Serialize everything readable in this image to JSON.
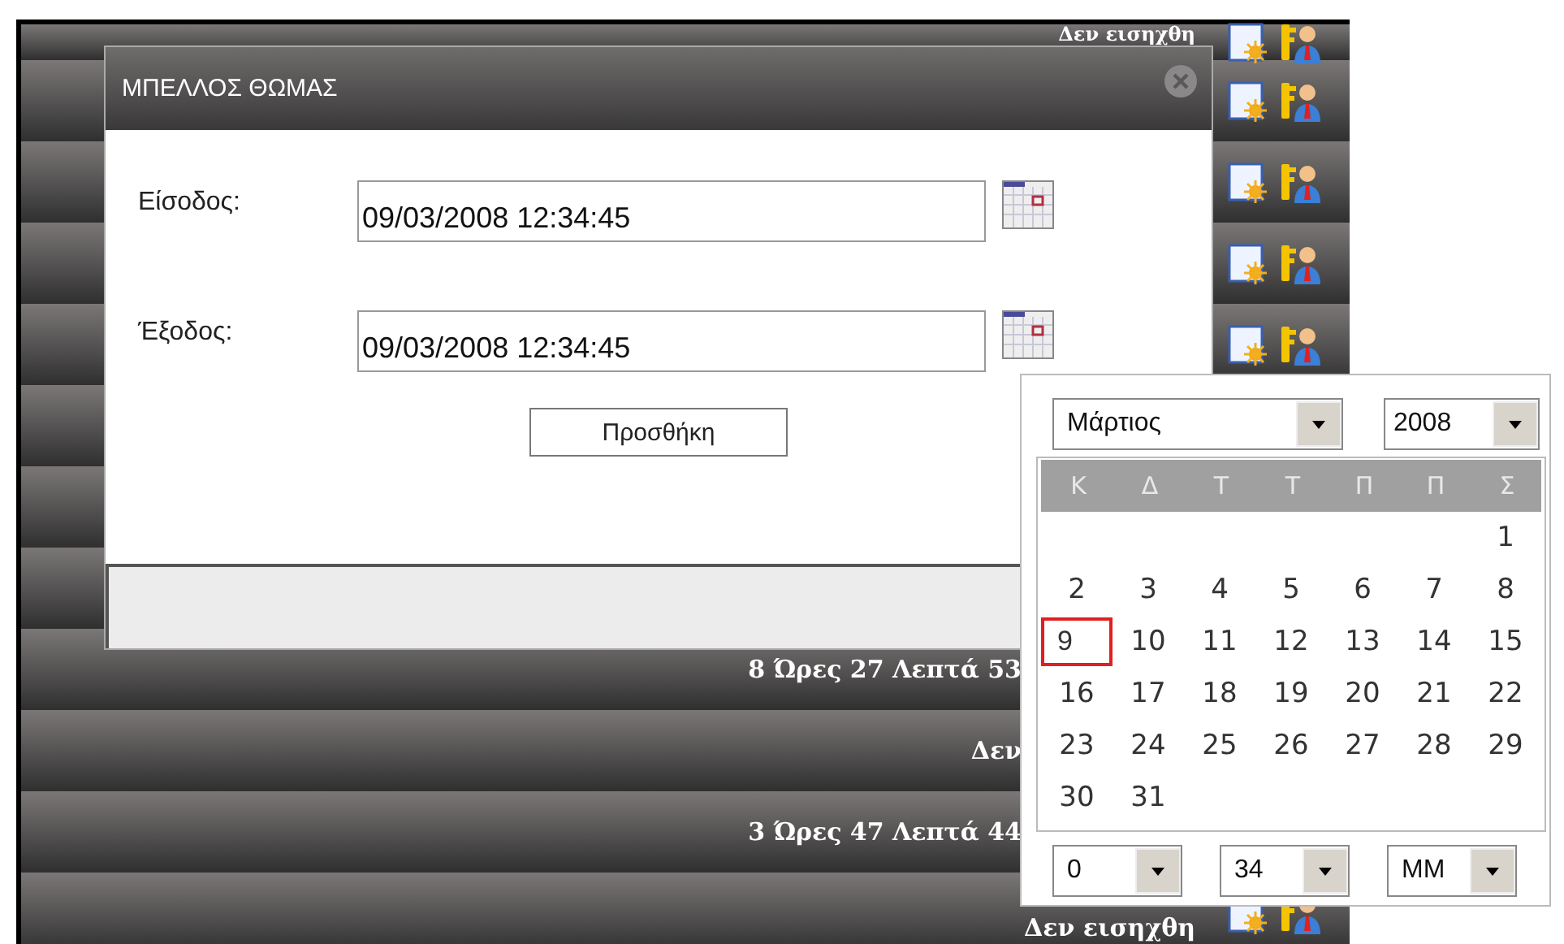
{
  "table": {
    "rows": [
      {
        "status": "Δεν εισηχθη",
        "icons": true
      },
      {
        "icons": true
      },
      {
        "icons": true
      },
      {
        "icons": true
      },
      {
        "icons": true
      },
      {},
      {},
      {},
      {
        "status": "8 Ώρες 27 Λεπτά 53"
      },
      {
        "status": "Δεν"
      },
      {
        "status": "3 Ώρες 47 Λεπτά 44"
      },
      {
        "status": "Δεν εισηχθη",
        "icons": true
      }
    ]
  },
  "dialog": {
    "title": "ΜΠΕΛΛΟΣ ΘΩΜΑΣ",
    "fields": [
      {
        "label": "Είσοδος:",
        "value": "09/03/2008 12:34:45"
      },
      {
        "label": "Έξοδος:",
        "value": "09/03/2008 12:34:45"
      }
    ],
    "button": "Προσθήκη"
  },
  "calendar": {
    "month": "Μάρτιος",
    "year": "2008",
    "weekdays": [
      "Κ",
      "Δ",
      "Τ",
      "Τ",
      "Π",
      "Π",
      "Σ"
    ],
    "weeks": [
      [
        {
          "day": "1",
          "selected": false
        }
      ],
      [
        {
          "day": "2",
          "selected": false
        },
        {
          "day": "3",
          "selected": false
        },
        {
          "day": "4",
          "selected": false
        },
        {
          "day": "5",
          "selected": false
        },
        {
          "day": "6",
          "selected": false
        },
        {
          "day": "7",
          "selected": false
        },
        {
          "day": "8",
          "selected": false
        }
      ],
      [
        {
          "day": "9",
          "selected": true
        },
        {
          "day": "10",
          "selected": false
        },
        {
          "day": "11",
          "selected": false
        },
        {
          "day": "12",
          "selected": false
        },
        {
          "day": "13",
          "selected": false
        },
        {
          "day": "14",
          "selected": false
        },
        {
          "day": "15",
          "selected": false
        }
      ],
      [
        {
          "day": "16",
          "selected": false
        },
        {
          "day": "17",
          "selected": false
        },
        {
          "day": "18",
          "selected": false
        },
        {
          "day": "19",
          "selected": false
        },
        {
          "day": "20",
          "selected": false
        },
        {
          "day": "21",
          "selected": false
        },
        {
          "day": "22",
          "selected": false
        }
      ],
      [
        {
          "day": "23",
          "selected": false
        },
        {
          "day": "24",
          "selected": false
        },
        {
          "day": "25",
          "selected": false
        },
        {
          "day": "26",
          "selected": false
        },
        {
          "day": "27",
          "selected": false
        },
        {
          "day": "28",
          "selected": false
        },
        {
          "day": "29",
          "selected": false
        }
      ],
      [
        {
          "day": "30",
          "selected": false
        },
        {
          "day": "31",
          "selected": false
        }
      ]
    ],
    "hour": "0",
    "minute": "34",
    "period": "MM"
  }
}
